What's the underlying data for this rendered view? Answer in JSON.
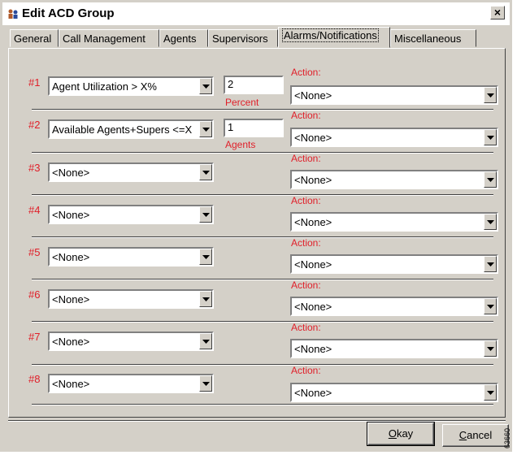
{
  "window": {
    "title": "Edit ACD Group",
    "close_glyph": "×"
  },
  "tabs": [
    {
      "label": "General"
    },
    {
      "label": "Call Management"
    },
    {
      "label": "Agents"
    },
    {
      "label": "Supervisors"
    },
    {
      "label": "Alarms/Notifications",
      "active": true
    },
    {
      "label": "Miscellaneous"
    }
  ],
  "rows": [
    {
      "num": "#1",
      "condition": "Agent Utilization > X%",
      "value": "2",
      "unit": "Percent",
      "action_label": "Action:",
      "action": "<None>"
    },
    {
      "num": "#2",
      "condition": "Available Agents+Supers <=X",
      "value": "1",
      "unit": "Agents",
      "action_label": "Action:",
      "action": "<None>"
    },
    {
      "num": "#3",
      "condition": "<None>",
      "action_label": "Action:",
      "action": "<None>"
    },
    {
      "num": "#4",
      "condition": "<None>",
      "action_label": "Action:",
      "action": "<None>"
    },
    {
      "num": "#5",
      "condition": "<None>",
      "action_label": "Action:",
      "action": "<None>"
    },
    {
      "num": "#6",
      "condition": "<None>",
      "action_label": "Action:",
      "action": "<None>"
    },
    {
      "num": "#7",
      "condition": "<None>",
      "action_label": "Action:",
      "action": "<None>"
    },
    {
      "num": "#8",
      "condition": "<None>",
      "action_label": "Action:",
      "action": "<None>"
    }
  ],
  "buttons": {
    "okay": {
      "mnemonic": "O",
      "rest": "kay"
    },
    "cancel": {
      "mnemonic": "C",
      "rest": "ancel"
    }
  },
  "figure_number": "63660",
  "icons": {
    "title": "acd-group-icon",
    "dropdown": "chevron-down-icon"
  }
}
